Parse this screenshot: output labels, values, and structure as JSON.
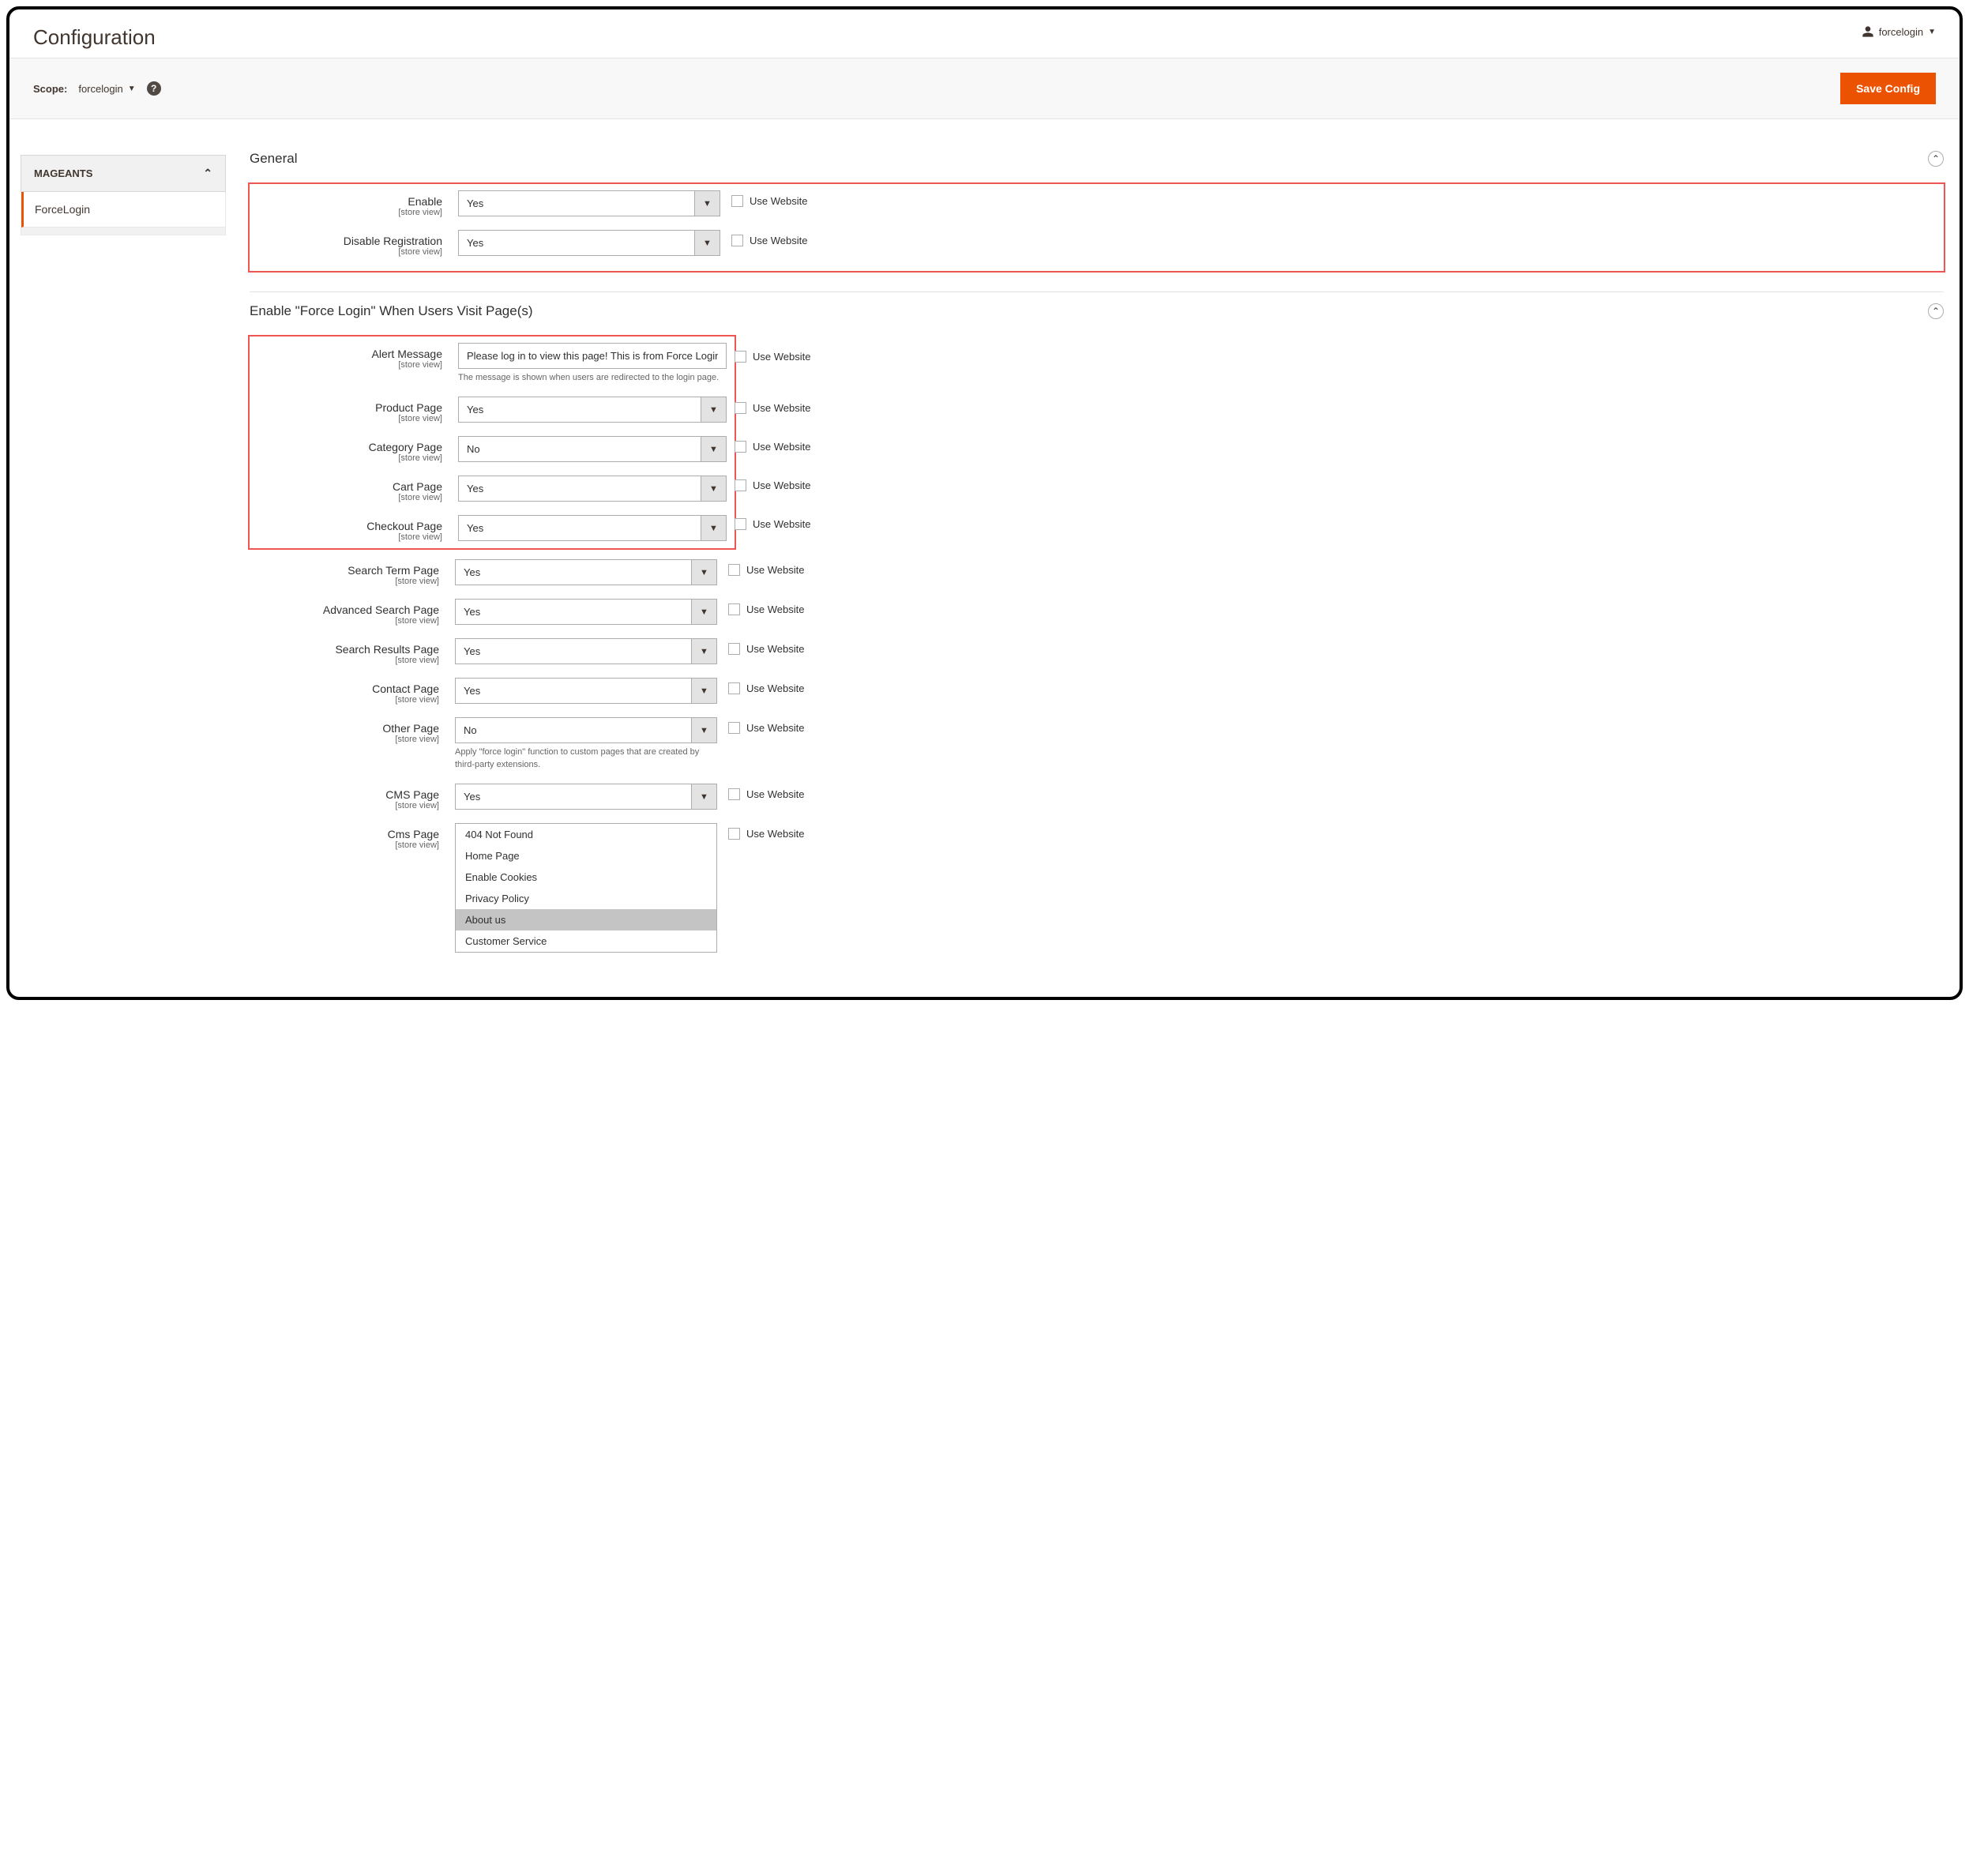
{
  "page_title": "Configuration",
  "user_menu_label": "forcelogin",
  "scope": {
    "label": "Scope:",
    "value": "forcelogin"
  },
  "save_button": "Save Config",
  "sidebar": {
    "group": "MAGEANTS",
    "item": "ForceLogin"
  },
  "store_view_hint": "[store view]",
  "use_website_label": "Use Website",
  "sections": {
    "general": {
      "title": "General",
      "fields": {
        "enable": {
          "label": "Enable",
          "value": "Yes"
        },
        "disable_reg": {
          "label": "Disable Registration",
          "value": "Yes"
        }
      }
    },
    "force": {
      "title": "Enable \"Force Login\" When Users Visit Page(s)",
      "fields": {
        "alert": {
          "label": "Alert Message",
          "value": "Please log in to view this page! This is from Force Login!!",
          "note": "The message is shown when users are redirected to the login page."
        },
        "product": {
          "label": "Product Page",
          "value": "Yes"
        },
        "category": {
          "label": "Category Page",
          "value": "No"
        },
        "cart": {
          "label": "Cart Page",
          "value": "Yes"
        },
        "checkout": {
          "label": "Checkout Page",
          "value": "Yes"
        },
        "searchterm": {
          "label": "Search Term Page",
          "value": "Yes"
        },
        "advsearch": {
          "label": "Advanced Search Page",
          "value": "Yes"
        },
        "searchres": {
          "label": "Search Results Page",
          "value": "Yes"
        },
        "contact": {
          "label": "Contact Page",
          "value": "Yes"
        },
        "other": {
          "label": "Other Page",
          "value": "No",
          "note": "Apply \"force login\" function to custom pages that are created by third-party extensions."
        },
        "cms": {
          "label": "CMS Page",
          "value": "Yes"
        },
        "cmspage": {
          "label": "Cms Page",
          "options": [
            "404 Not Found",
            "Home Page",
            "Enable Cookies",
            "Privacy Policy",
            "About us",
            "Customer Service"
          ],
          "selected": "About us"
        }
      }
    }
  }
}
